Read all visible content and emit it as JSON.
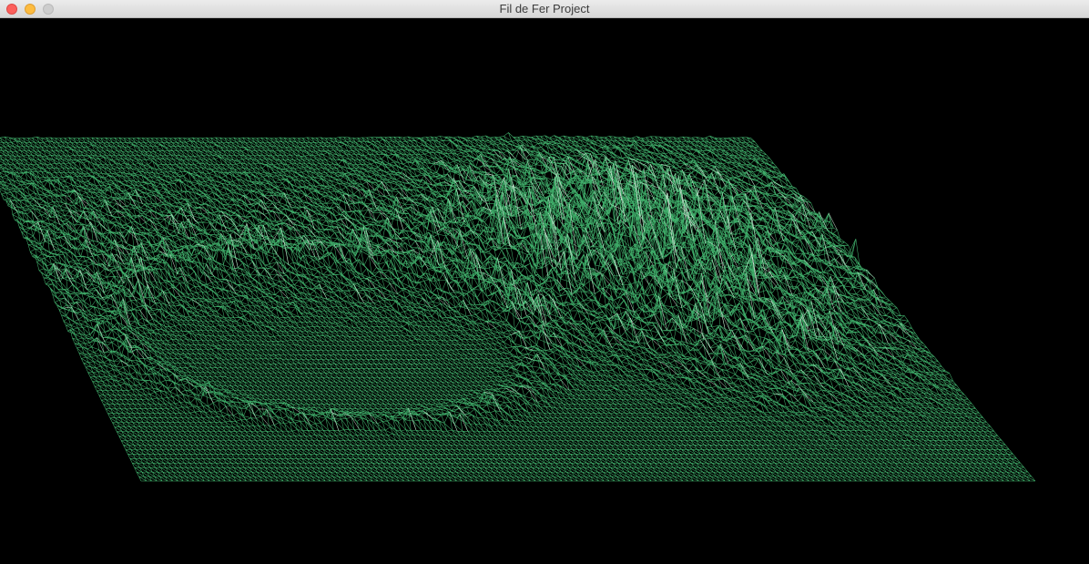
{
  "window": {
    "title": "Fil de Fer Project",
    "buttons": [
      "close",
      "minimize",
      "zoom"
    ]
  },
  "render": {
    "mode": "isometric wireframe",
    "line_color": "#3fae6a",
    "highlight_color": "#d8e8dc",
    "background": "#000000"
  }
}
